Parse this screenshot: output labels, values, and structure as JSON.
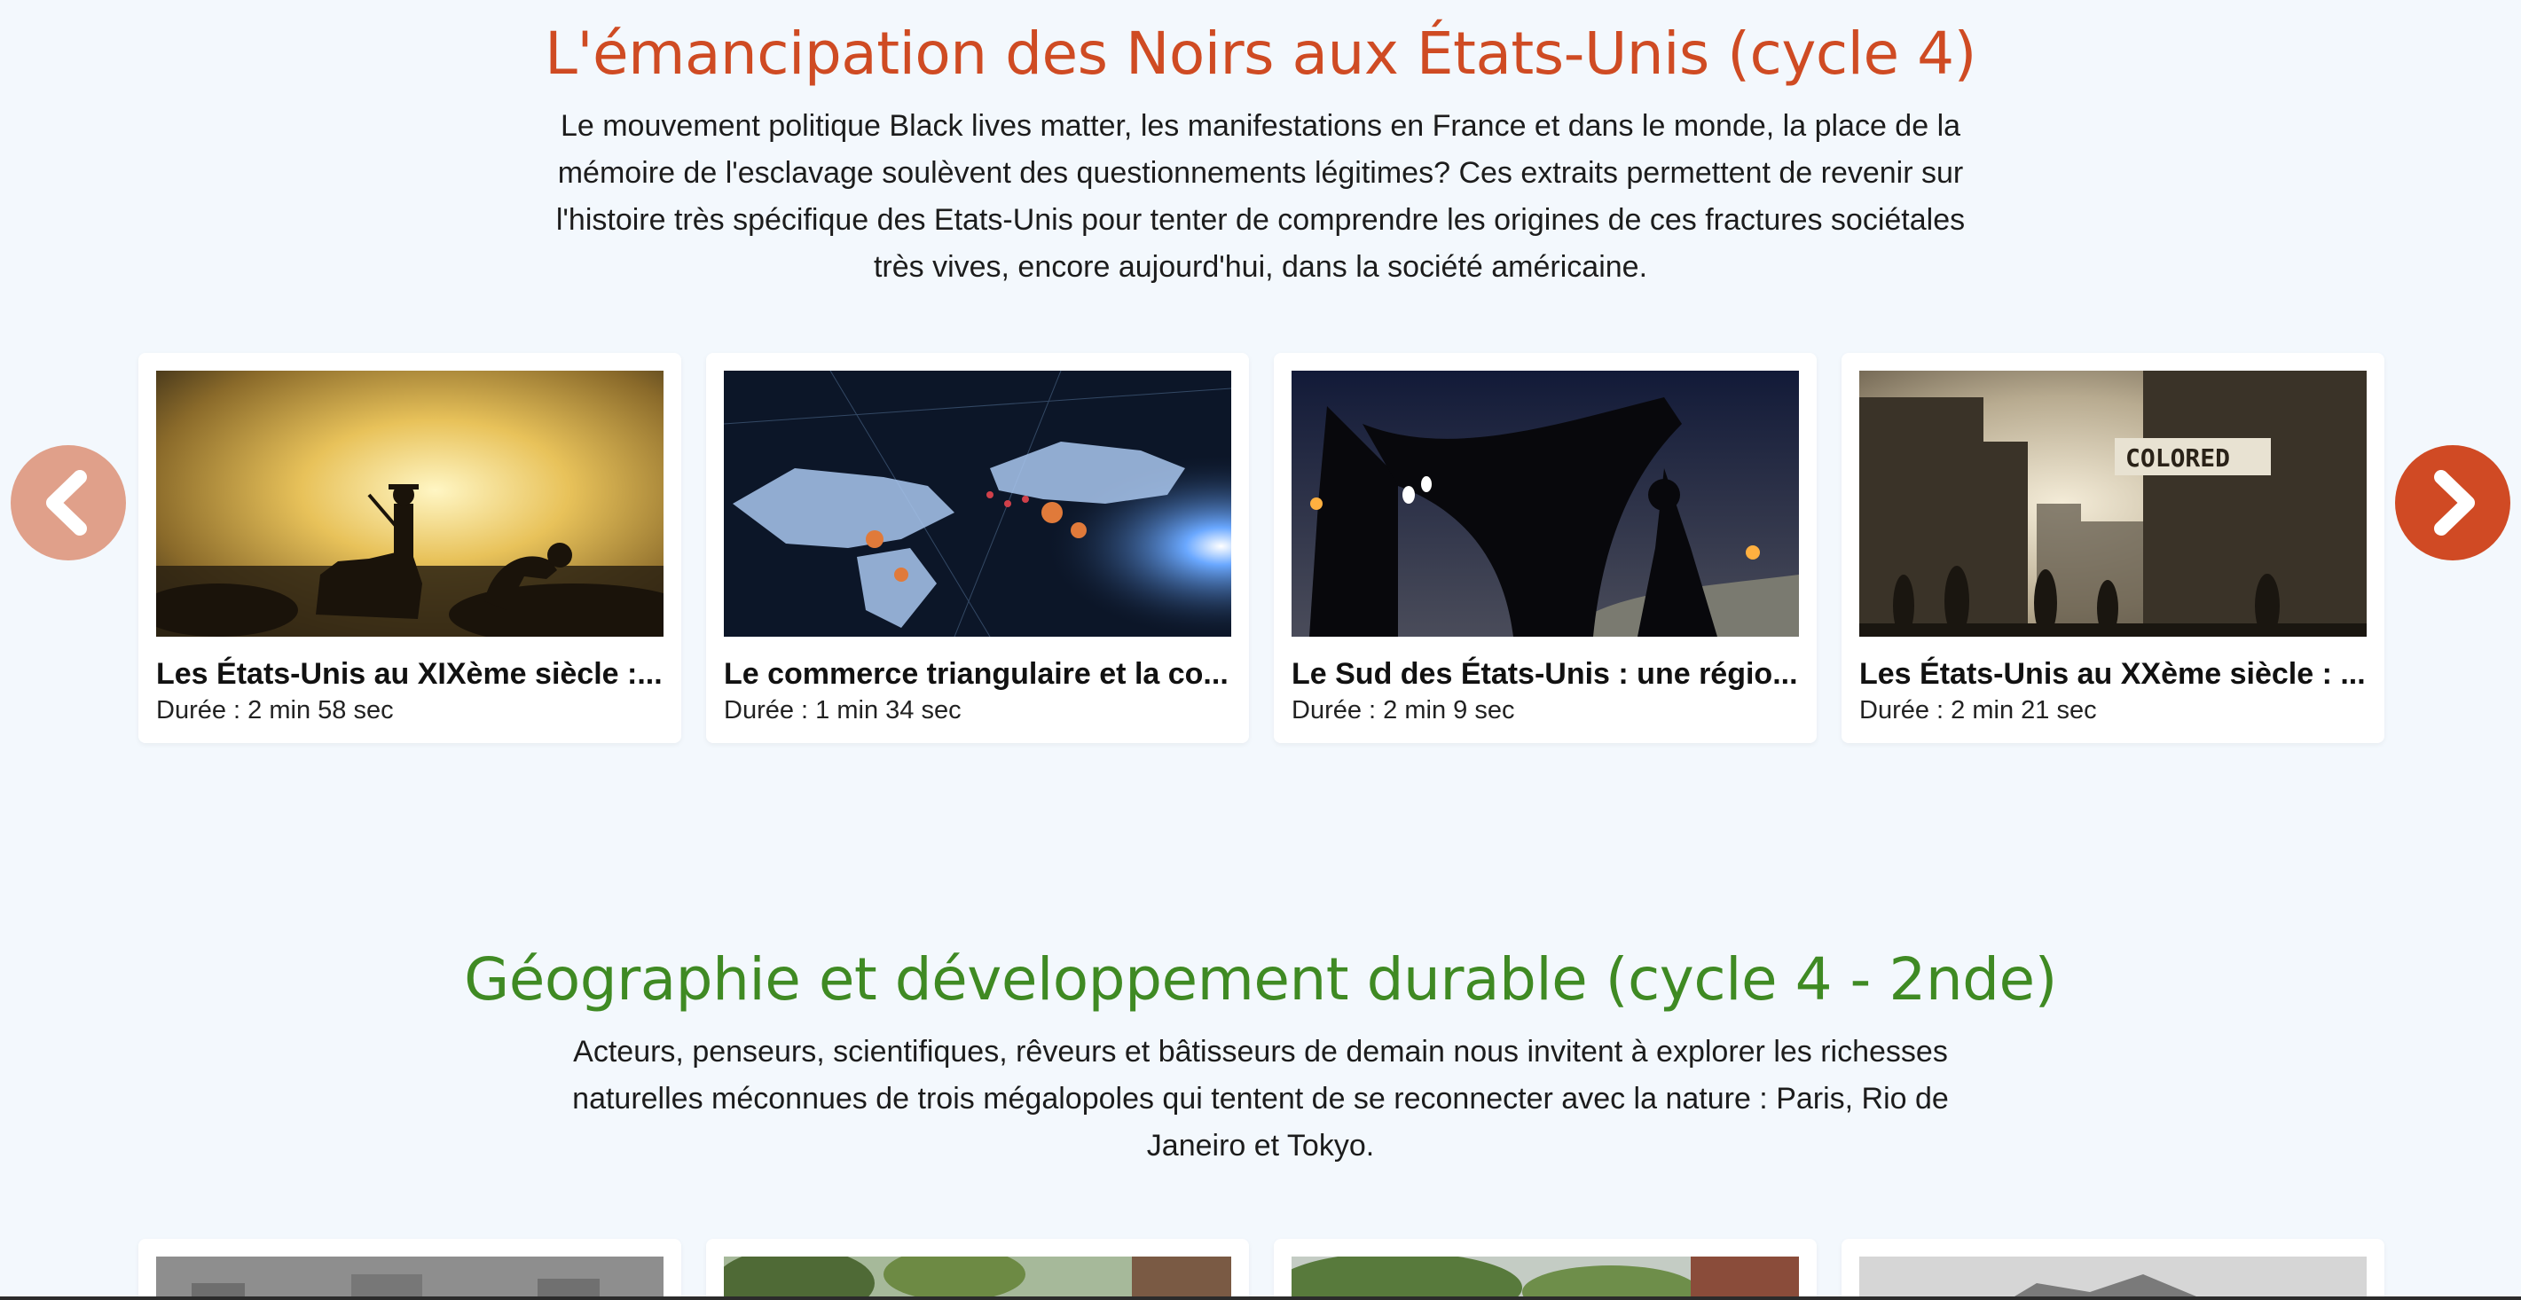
{
  "colors": {
    "background": "#f3f8fd",
    "section1_title": "#cf4b23",
    "section2_title": "#3f8a23",
    "arrow_prev": "#e0a08a",
    "arrow_next": "#d04a24"
  },
  "section1": {
    "title": "L'émancipation des Noirs aux États-Unis (cycle 4)",
    "description": "Le mouvement politique Black lives matter, les manifestations en France et dans le monde, la place de la mémoire de l'esclavage soulèvent des questionnements légitimes? Ces extraits permettent de revenir sur l'histoire très spécifique des Etats-Unis pour tenter de comprendre les origines de ces fractures sociétales très vives, encore aujourd'hui, dans la société américaine.",
    "cards": [
      {
        "title": "Les États-Unis au XIXème siècle :...",
        "duration": "Durée : 2 min 58 sec"
      },
      {
        "title": "Le commerce triangulaire et la co...",
        "duration": "Durée : 1 min 34 sec"
      },
      {
        "title": "Le Sud des États-Unis : une régio...",
        "duration": "Durée : 2 min 9 sec"
      },
      {
        "title": "Les États-Unis au XXème siècle : ...",
        "duration": "Durée : 2 min 21 sec"
      }
    ],
    "thumbnail_sign": "COLORED",
    "prev_icon": "chevron-left-icon",
    "next_icon": "chevron-right-icon"
  },
  "section2": {
    "title": "Géographie et développement durable (cycle 4 - 2nde)",
    "description": "Acteurs, penseurs, scientifiques, rêveurs et bâtisseurs de demain nous invitent à explorer les richesses naturelles méconnues de trois mégalopoles qui tentent de se reconnecter avec la nature : Paris, Rio de Janeiro et Tokyo."
  }
}
